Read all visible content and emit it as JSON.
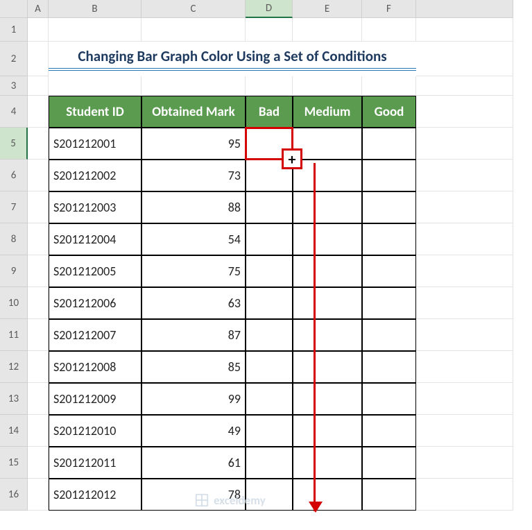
{
  "columns": [
    "A",
    "B",
    "C",
    "D",
    "E",
    "F"
  ],
  "row_labels": [
    "1",
    "2",
    "3",
    "4",
    "5",
    "6",
    "7",
    "8",
    "9",
    "10",
    "11",
    "12",
    "13",
    "14",
    "15",
    "16"
  ],
  "title": "Changing Bar Graph Color Using a Set of Conditions",
  "headers": {
    "b": "Student ID",
    "c": "Obtained Mark",
    "d": "Bad",
    "e": "Medium",
    "f": "Good"
  },
  "rows": [
    {
      "id": "S201212001",
      "mark": "95"
    },
    {
      "id": "S201212002",
      "mark": "73"
    },
    {
      "id": "S201212003",
      "mark": "88"
    },
    {
      "id": "S201212004",
      "mark": "54"
    },
    {
      "id": "S201212005",
      "mark": "75"
    },
    {
      "id": "S201212006",
      "mark": "63"
    },
    {
      "id": "S201212007",
      "mark": "87"
    },
    {
      "id": "S201212008",
      "mark": "85"
    },
    {
      "id": "S201212009",
      "mark": "99"
    },
    {
      "id": "S201212010",
      "mark": "49"
    },
    {
      "id": "S201212011",
      "mark": "61"
    },
    {
      "id": "S201212012",
      "mark": "78"
    }
  ],
  "active_column": "D",
  "active_row": "5",
  "fill_handle_symbol": "+",
  "watermark": "exceldemy"
}
